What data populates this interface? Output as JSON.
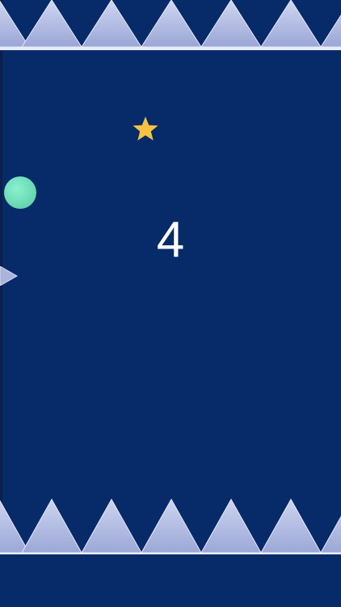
{
  "game": {
    "score": "4",
    "colors": {
      "background": "#072a69",
      "spike": "#b8c3e6",
      "ball": "#6cdcb6",
      "star": "#f5c242",
      "score_text": "#ffffff"
    }
  },
  "icons": {
    "ball": "ball-icon",
    "star": "star-icon",
    "spike": "triangle-spike-icon"
  }
}
